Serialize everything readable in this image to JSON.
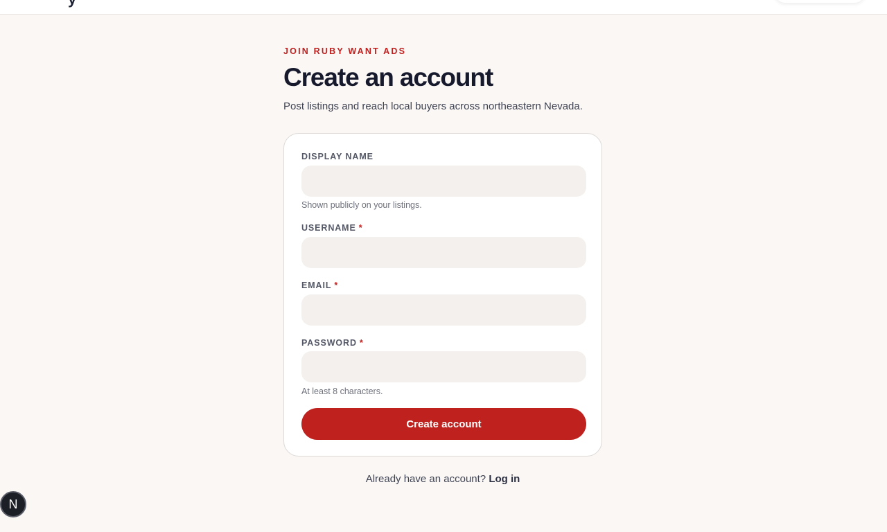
{
  "header": {
    "logo_fragment": "y"
  },
  "intro": {
    "eyebrow": "JOIN RUBY WANT ADS",
    "title": "Create an account",
    "subtitle": "Post listings and reach local buyers across northeastern Nevada."
  },
  "form": {
    "display_name": {
      "label": "DISPLAY NAME",
      "value": "",
      "hint": "Shown publicly on your listings."
    },
    "username": {
      "label": "USERNAME",
      "required_mark": "*",
      "value": ""
    },
    "email": {
      "label": "EMAIL",
      "required_mark": "*",
      "value": ""
    },
    "password": {
      "label": "PASSWORD",
      "required_mark": "*",
      "value": "",
      "hint": "At least 8 characters."
    },
    "submit_label": "Create account"
  },
  "footer": {
    "prompt": "Already have an account?",
    "login_label": "Log in"
  },
  "dev_badge": {
    "letter": "N",
    "icon": "nextjs-logo-icon"
  },
  "colors": {
    "accent": "#bf211e",
    "page_background": "#faf7f5",
    "input_background": "#f4f0ed"
  }
}
